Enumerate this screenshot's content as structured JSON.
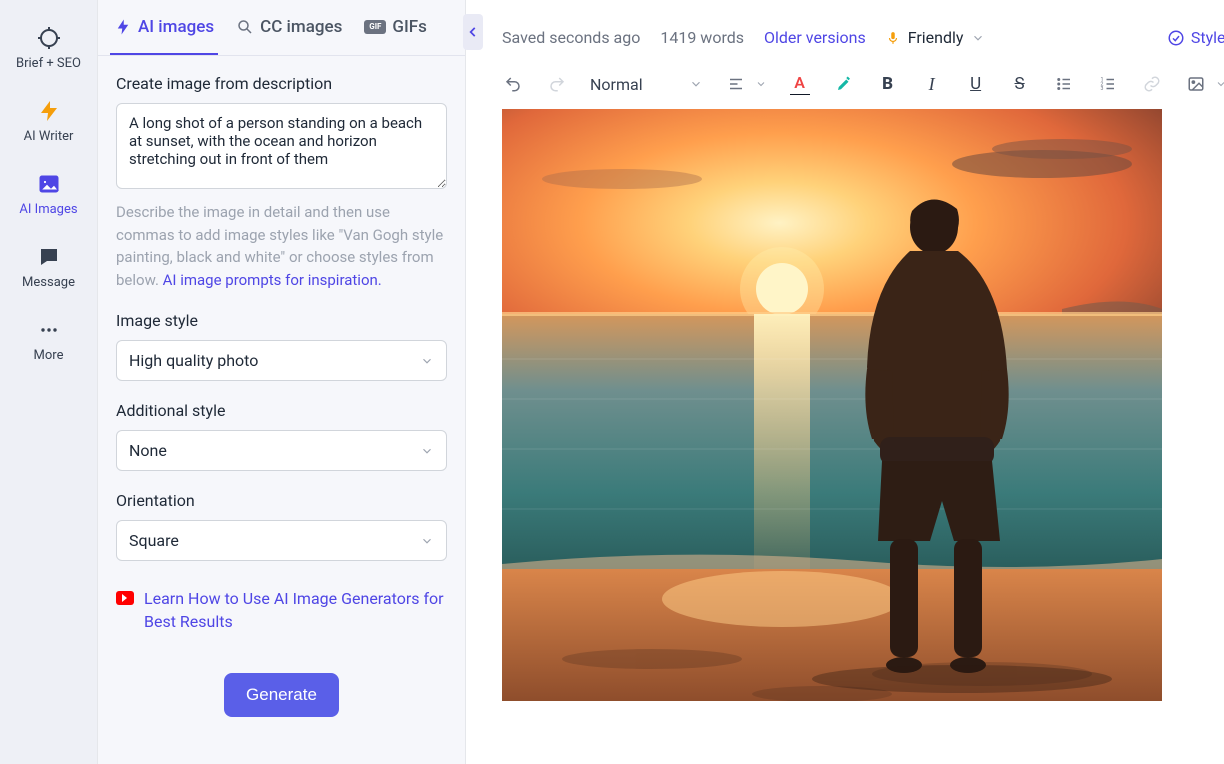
{
  "nav_rail": {
    "items": [
      {
        "label": "Brief + SEO"
      },
      {
        "label": "AI Writer"
      },
      {
        "label": "AI Images"
      },
      {
        "label": "Message"
      },
      {
        "label": "More"
      }
    ]
  },
  "side_panel": {
    "tabs": [
      {
        "label": "AI images"
      },
      {
        "label": "CC images"
      },
      {
        "label": "GIFs"
      }
    ],
    "prompt_label": "Create image from description",
    "prompt_value": "A long shot of a person standing on a beach at sunset, with the ocean and horizon stretching out in front of them",
    "helper_text_before": "Describe the image in detail and then use commas to add image styles like \"Van Gogh style painting, black and white\" or choose styles from below. ",
    "helper_link": "AI image prompts for inspiration.",
    "style_label": "Image style",
    "style_value": "High quality photo",
    "additional_label": "Additional style",
    "additional_value": "None",
    "orientation_label": "Orientation",
    "orientation_value": "Square",
    "learn_link": "Learn How to Use AI Image Generators for Best Results",
    "generate_label": "Generate"
  },
  "editor_header": {
    "saved_text": "Saved seconds ago",
    "word_count": "1419 words",
    "older_versions": "Older versions",
    "tone_label": "Friendly",
    "style_guide": "Style Guide",
    "format_select": "Normal"
  }
}
